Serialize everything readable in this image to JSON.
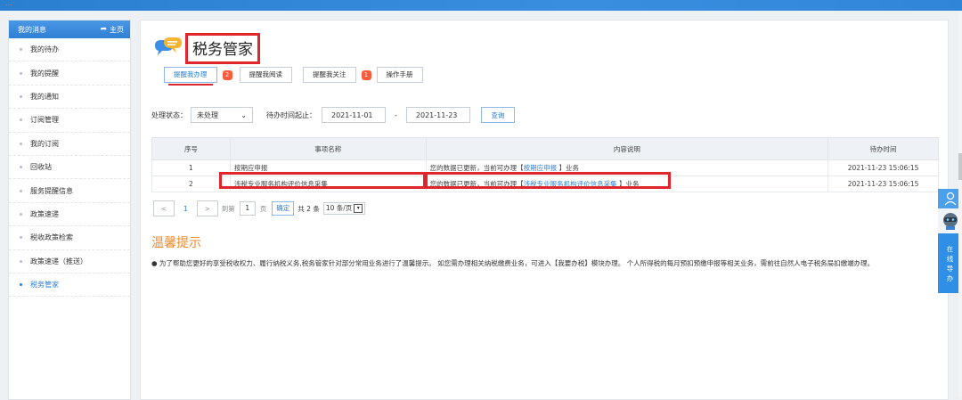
{
  "brand": "...",
  "sidebar": {
    "header": "我的消息",
    "home": "主页",
    "items": [
      {
        "label": "我的待办"
      },
      {
        "label": "我的提醒"
      },
      {
        "label": "我的通知"
      },
      {
        "label": "订阅管理"
      },
      {
        "label": "我的订阅"
      },
      {
        "label": "回收站"
      },
      {
        "label": "服务提醒信息"
      },
      {
        "label": "政策速递"
      },
      {
        "label": "税收政策检索"
      },
      {
        "label": "政策速递（推送）"
      },
      {
        "label": "税务管家"
      }
    ]
  },
  "main": {
    "title": "税务管家",
    "tabs": [
      {
        "label": "提醒我办理",
        "badge": "2"
      },
      {
        "label": "提醒我阅读"
      },
      {
        "label": "提醒我关注",
        "badge": "1"
      },
      {
        "label": "操作手册"
      }
    ],
    "filter": {
      "status_label": "处理状态：",
      "status_value": "未处理",
      "time_label": "待办时间起止：",
      "start_date": "2021-11-01",
      "dash": "-",
      "end_date": "2021-11-23",
      "query": "查询"
    },
    "table": {
      "headers": [
        "序号",
        "事项名称",
        "内容说明",
        "待办时间"
      ],
      "rows": [
        {
          "no": "1",
          "name": "按期应申报",
          "desc_prefix": "您的数据已更新，当前可办理【",
          "desc_link": "按期应申报",
          "desc_suffix": " 】业务",
          "time": "2021-11-23 15:06:15"
        },
        {
          "no": "2",
          "name": "涉税专业服务机构评价信息采集",
          "desc_prefix": "您的数据已更新，当前可办理【",
          "desc_link": "涉税专业服务机构评价信息采集",
          "desc_suffix": " 】业务",
          "time": "2021-11-23 15:06:15"
        }
      ]
    },
    "pager": {
      "prev": "<",
      "page": "1",
      "next": ">",
      "goto": "到第",
      "input": "1",
      "page_unit": "页",
      "confirm": "确定",
      "total": "共 2 条",
      "size": "10 条/页"
    },
    "tip": {
      "title": "温馨提示",
      "text": "● 为了帮助您更好的享受税收权力、履行纳税义务,税务管家针对部分常用业务进行了温馨提示。 如您需办理相关纳税缴费业务，可进入【我要办税】模块办理。 个人所得税的每月预扣预缴申报等相关业务，需前往自然人电子税务局扣缴端办理。"
    }
  },
  "widget": {
    "text": [
      "在",
      "线",
      "导",
      "办"
    ]
  },
  "colors": {
    "accent": "#2f7fd3",
    "highlight": "#e0262c",
    "badge": "#ff5b3b",
    "tip_title": "#f08a2b"
  }
}
